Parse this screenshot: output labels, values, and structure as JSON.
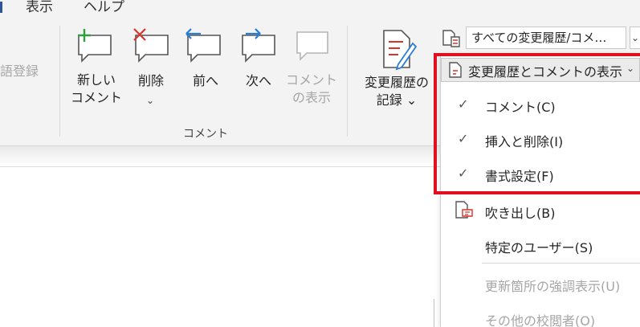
{
  "tabs": {
    "view": "表示",
    "help": "ヘルプ"
  },
  "ribbon": {
    "partial_label": "語登録",
    "buttons": {
      "new_comment": {
        "line1": "新しい",
        "line2": "コメント"
      },
      "delete": {
        "label": "削除"
      },
      "previous": {
        "label": "前へ"
      },
      "next": {
        "label": "次へ"
      },
      "show_comments": {
        "line1": "コメント",
        "line2": "の表示"
      },
      "track_changes": {
        "line1": "変更履歴の",
        "line2": "記録"
      }
    },
    "comment_group_label": "コメント",
    "markup_combo": {
      "value": "すべての変更履歴/コメ…"
    }
  },
  "menu": {
    "header": "変更履歴とコメントの表示",
    "items": [
      {
        "label": "コメント(C)",
        "checked": true
      },
      {
        "label": "挿入と削除(I)",
        "checked": true
      },
      {
        "label": "書式設定(F)",
        "checked": true
      },
      {
        "label": "吹き出し(B)",
        "icon": "balloon-icon"
      },
      {
        "label": "特定のユーザー(S)"
      },
      {
        "label": "更新箇所の強調表示(U)",
        "disabled": true
      },
      {
        "label": "その他の校閲者(O)",
        "disabled": true
      }
    ]
  },
  "colors": {
    "highlight": "#e01020",
    "accent_green": "#2e9e3e",
    "accent_red": "#d9342b",
    "accent_blue": "#2b7cd3"
  }
}
